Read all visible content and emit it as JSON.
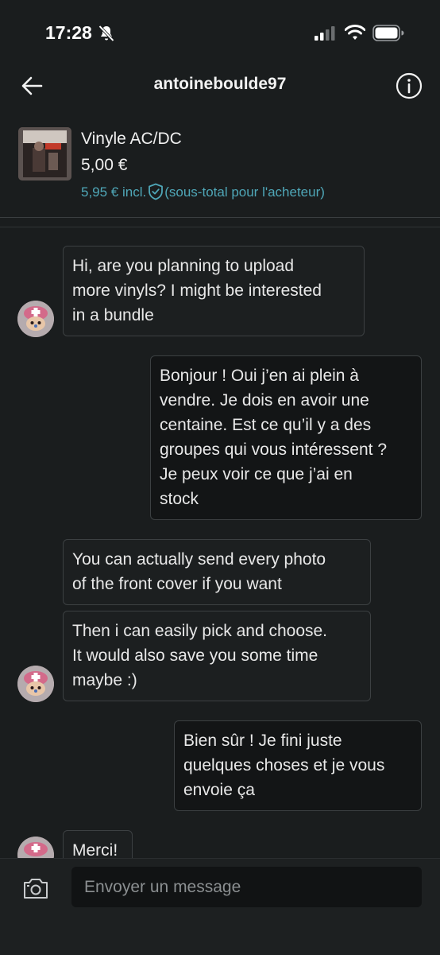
{
  "status_bar": {
    "time": "17:28",
    "icons": [
      "bell-off-icon",
      "signal-icon",
      "wifi-icon",
      "battery-icon"
    ]
  },
  "header": {
    "title": "antoineboulde97",
    "icons": [
      "back-arrow-icon",
      "info-icon"
    ]
  },
  "item": {
    "title": "Vinyle AC/DC",
    "price": "5,00 €",
    "total_price": "5,95 € incl.",
    "total_note": "(sous-total pour l'acheteur)",
    "thumbnail_icon": "album-cover-thumbnail"
  },
  "messages": [
    {
      "from": "other",
      "text": "Hi, are you planning to upload\nmore vinyls? I might be interested\nin a bundle"
    },
    {
      "from": "me",
      "text": "Bonjour ! Oui j’en ai plein à\nvendre. Je dois en avoir une\ncentaine. Est ce qu’il y a des\ngroupes qui vous intéressent ?\nJe peux voir ce que j’ai en\nstock"
    },
    {
      "from": "other",
      "text": "You can actually send every photo\nof the front cover if you want"
    },
    {
      "from": "other",
      "text": "Then i can easily pick and choose.\nIt would also save you some time\nmaybe :)"
    },
    {
      "from": "me",
      "text": "Bien sûr ! Je fini juste\nquelques choses et je vous\nenvoie ça"
    },
    {
      "from": "other",
      "text": "Merci!"
    }
  ],
  "composer": {
    "placeholder": "Envoyer un message",
    "value": "",
    "icons": [
      "camera-icon"
    ]
  },
  "colors": {
    "background": "#1a1d1e",
    "accent": "#4fa7b8",
    "bubble_border": "#3c4042"
  }
}
